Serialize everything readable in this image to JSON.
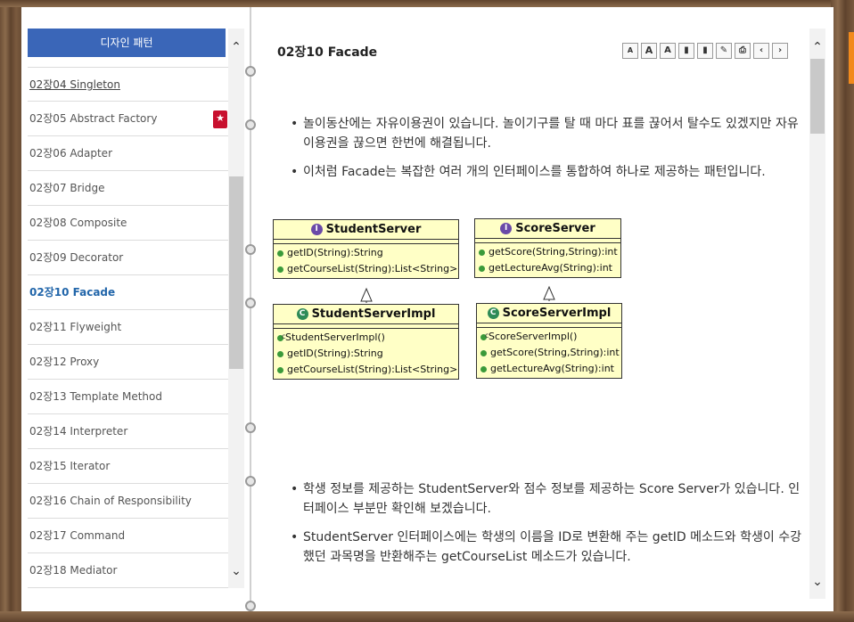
{
  "nav": {
    "header": "디자인 패턴",
    "items": [
      {
        "label": "02장04 Singleton",
        "state": "link"
      },
      {
        "label": "02장05 Abstract Factory",
        "state": "bookmarked"
      },
      {
        "label": "02장06 Adapter",
        "state": "normal"
      },
      {
        "label": "02장07 Bridge",
        "state": "normal"
      },
      {
        "label": "02장08 Composite",
        "state": "normal"
      },
      {
        "label": "02장09 Decorator",
        "state": "normal"
      },
      {
        "label": "02장10 Facade",
        "state": "active"
      },
      {
        "label": "02장11 Flyweight",
        "state": "normal"
      },
      {
        "label": "02장12 Proxy",
        "state": "normal"
      },
      {
        "label": "02장13 Template Method",
        "state": "normal"
      },
      {
        "label": "02장14 Interpreter",
        "state": "normal"
      },
      {
        "label": "02장15 Iterator",
        "state": "normal"
      },
      {
        "label": "02장16 Chain of Responsibility",
        "state": "normal"
      },
      {
        "label": "02장17 Command",
        "state": "normal"
      },
      {
        "label": "02장18 Mediator",
        "state": "normal"
      }
    ]
  },
  "content": {
    "title": "02장10 Facade",
    "toolbar_icons": [
      "font-decrease-icon",
      "font-increase-icon",
      "font-reset-icon",
      "bookmark-icon",
      "bookmark-list-icon",
      "memo-icon",
      "print-icon",
      "prev-page-icon",
      "next-page-icon"
    ],
    "toolbar_glyphs": [
      "A",
      "A",
      "A",
      "▮",
      "▮",
      "✎",
      "⎙",
      "‹",
      "›"
    ],
    "bullets_top": [
      "놀이동산에는 자유이용권이 있습니다. 놀이기구를 탈 때 마다 표를 끊어서 탈수도 있겠지만 자유이용권을 끊으면 한번에 해결됩니다.",
      "이처럼 Facade는 복잡한 여러 개의 인터페이스를 통합하여 하나로 제공하는 패턴입니다."
    ],
    "bullets_bottom": [
      "학생 정보를 제공하는 StudentServer와 점수 정보를 제공하는 Score Server가 있습니다. 인터페이스 부분만 확인해 보겠습니다.",
      "StudentServer 인터페이스에는 학생의 이름을 ID로 변환해 주는 getID 메소드와 학생이 수강했던 과목명을 반환해주는 getCourseList 메소드가 있습니다."
    ]
  },
  "uml": {
    "student_server": {
      "badge": "I",
      "name": "StudentServer",
      "methods": [
        "getID(String):String",
        "getCourseList(String):List<String>"
      ]
    },
    "score_server": {
      "badge": "I",
      "name": "ScoreServer",
      "methods": [
        "getScore(String,String):int",
        "getLectureAvg(String):int"
      ]
    },
    "student_server_impl": {
      "badge": "C",
      "name": "StudentServerImpl",
      "ctor": "StudentServerImpl()",
      "methods": [
        "getID(String):String",
        "getCourseList(String):List<String>"
      ]
    },
    "score_server_impl": {
      "badge": "C",
      "name": "ScoreServerImpl",
      "ctor": "ScoreServerImpl()",
      "methods": [
        "getScore(String,String):int",
        "getLectureAvg(String):int"
      ]
    }
  },
  "colors": {
    "nav_header_bg": "#3a66b8",
    "active_link": "#2266aa",
    "uml_box": "#ffffc6",
    "frame_wood": "#7a5a3e"
  }
}
